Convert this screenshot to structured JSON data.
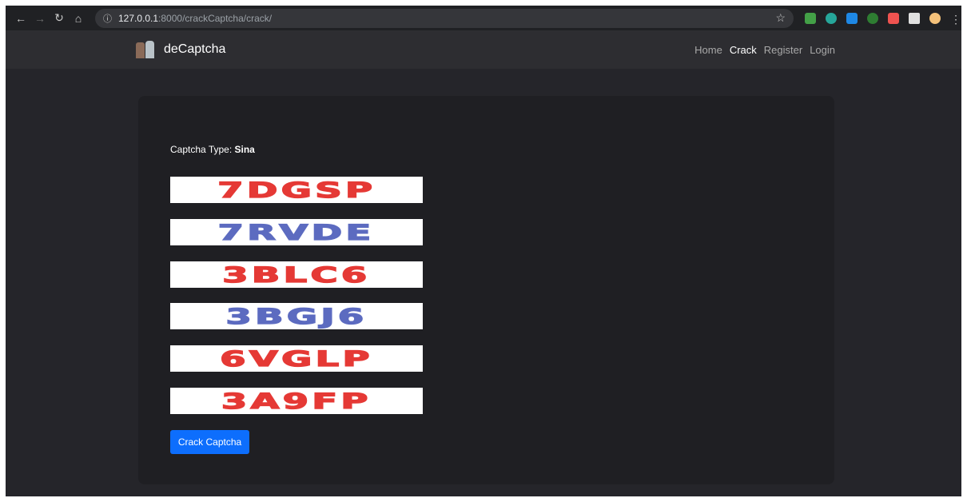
{
  "browser": {
    "url_host": "127.0.0.1",
    "url_rest": ":8000/crackCaptcha/crack/",
    "icons": [
      "back-arrow-icon",
      "forward-arrow-icon",
      "reload-icon",
      "home-icon",
      "info-icon",
      "star-icon",
      "kebab-menu-icon"
    ]
  },
  "navbar": {
    "brand": "deCaptcha",
    "links": {
      "home": "Home",
      "crack": "Crack",
      "register": "Register",
      "login": "Login"
    }
  },
  "form": {
    "type_label": "Captcha Type:",
    "type_value": "Sina",
    "captchas": [
      {
        "text": "7DGSP",
        "color": "#e53935"
      },
      {
        "text": "7RVDE",
        "color": "#5c6bc0"
      },
      {
        "text": "3BLC6",
        "color": "#e53935"
      },
      {
        "text": "3BGJ6",
        "color": "#5c6bc0"
      },
      {
        "text": "6VGLP",
        "color": "#e53935"
      },
      {
        "text": "3A9FP",
        "color": "#e53935"
      }
    ],
    "button_label": "Crack Captcha"
  },
  "colors": {
    "accent": "#0d6efd",
    "page_bg": "#25252a",
    "card_bg": "#1f1f23"
  }
}
